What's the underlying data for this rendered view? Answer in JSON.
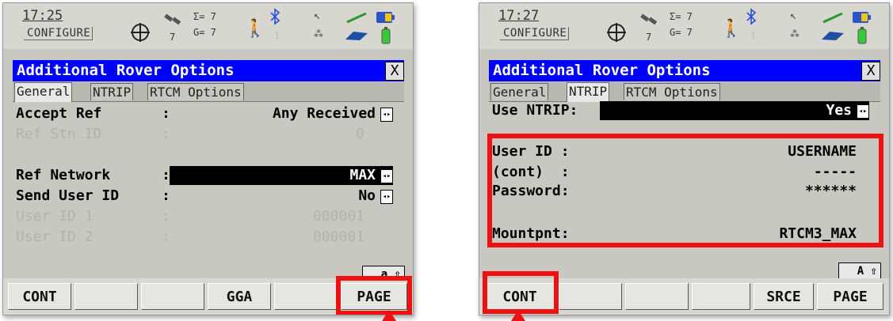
{
  "screens": [
    {
      "status": {
        "time": "17:25",
        "mode": "CONFIGURE",
        "sat_sigma": "Σ= 7",
        "sat_g": "G= 7",
        "sat_count": "7",
        "bt_count": "1"
      },
      "title": "Additional Rover Options",
      "close_label": "X",
      "tabs": [
        {
          "label": "General",
          "active": true
        },
        {
          "label": "NTRIP",
          "active": false
        },
        {
          "label": "RTCM Options",
          "active": false
        }
      ],
      "rows": {
        "accept_ref": {
          "label": "Accept Ref",
          "colon": ":",
          "value": "Any Received"
        },
        "ref_stn_id": {
          "label": "Ref Stn ID",
          "colon": ":",
          "value": "0"
        },
        "ref_network": {
          "label": "Ref Network",
          "colon": ":",
          "value": "MAX"
        },
        "send_user_id": {
          "label": "Send User ID",
          "colon": ":",
          "value": "No"
        },
        "user_id_1": {
          "label": "User ID 1",
          "colon": ":",
          "value": "000001"
        },
        "user_id_2": {
          "label": "User ID 2",
          "colon": ":",
          "value": "000001"
        }
      },
      "indicator": "a ⇧",
      "fkeys": [
        "CONT",
        "",
        "",
        "GGA",
        "",
        "PAGE"
      ]
    },
    {
      "status": {
        "time": "17:27",
        "mode": "CONFIGURE",
        "sat_sigma": "Σ= 7",
        "sat_g": "G= 7",
        "sat_count": "7",
        "bt_count": "1"
      },
      "title": "Additional Rover Options",
      "close_label": "X",
      "tabs": [
        {
          "label": "General",
          "active": false
        },
        {
          "label": "NTRIP",
          "active": true
        },
        {
          "label": "RTCM Options",
          "active": false
        }
      ],
      "rows": {
        "use_ntrip": {
          "label": "Use NTRIP:",
          "value": "Yes"
        },
        "user_id": {
          "label": "User ID :",
          "value": "USERNAME"
        },
        "cont": {
          "label": "(cont)  :",
          "value": "-----"
        },
        "password": {
          "label": "Password:",
          "value": "******"
        },
        "mountpnt": {
          "label": "Mountpnt:",
          "value": "RTCM3_MAX"
        }
      },
      "indicator": "A ⇧",
      "fkeys": [
        "CONT",
        "",
        "",
        "",
        "SRCE",
        "PAGE"
      ]
    }
  ],
  "colors": {
    "title_bg": "#0000ff",
    "highlight": "#ee1111",
    "screen_bg": "#c8c8c0"
  },
  "icons": [
    "crosshair-icon",
    "satellite-icon",
    "signal-icon",
    "walking-man-icon",
    "bluetooth-icon",
    "pen-icon",
    "card-icon",
    "battery-icon"
  ]
}
